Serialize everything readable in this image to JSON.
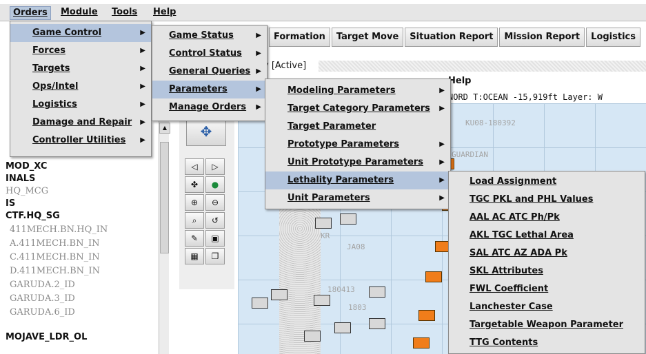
{
  "menubar": [
    "Orders",
    "Module",
    "Tools",
    "Help"
  ],
  "toolbar": [
    "Formation",
    "Target Move",
    "Situation Report",
    "Mission Report",
    "Logistics"
  ],
  "active_label": "v [Active]",
  "help_label": "Help",
  "coord_readout": "NORD T:OCEAN   -15,919ft Layer: W",
  "menu_orders": [
    "Game Control",
    "Forces",
    "Targets",
    "Ops/Intel",
    "Logistics",
    "Damage and Repair",
    "Controller Utilities"
  ],
  "menu_game_control": [
    "Game Status",
    "Control Status",
    "General Queries",
    "Parameters",
    "Manage Orders"
  ],
  "menu_parameters": [
    "Modeling Parameters",
    "Target Category Parameters",
    "Target Parameter",
    "Prototype Parameters",
    "Unit Prototype Parameters",
    "Lethality Parameters",
    "Unit Parameters"
  ],
  "menu_lethality": [
    "Load Assignment",
    "TGC PKL and PHL Values",
    "AAL AC ATC Ph/Pk",
    "AKL TGC Lethal Area",
    "SAL ATC AZ ADA Pk",
    "SKL Attributes",
    "FWL Coefficient",
    "Lanchester Case",
    "Targetable Weapon Parameter",
    "TTG Contents"
  ],
  "tree": [
    "MOD_XC",
    "INALS",
    "HQ_MCG",
    "IS",
    "CTF.HQ_SG",
    "411MECH.BN.HQ_IN",
    "A.411MECH.BN_IN",
    "C.411MECH.BN_IN",
    "D.411MECH.BN_IN",
    "GARUDA.2_ID",
    "GARUDA.3_ID",
    "GARUDA.6_ID",
    "MOJAVE_LDR_OL"
  ],
  "map_labels": [
    "KU08-180392",
    "GUARDIAN",
    "KR",
    "JA08",
    "180413",
    "1803"
  ],
  "colors": {
    "menu_bg": "#e4e4e4",
    "highlight": "#b4c5dd",
    "map_water": "#d6e7f5",
    "unit_orange": "#f07d1a"
  }
}
